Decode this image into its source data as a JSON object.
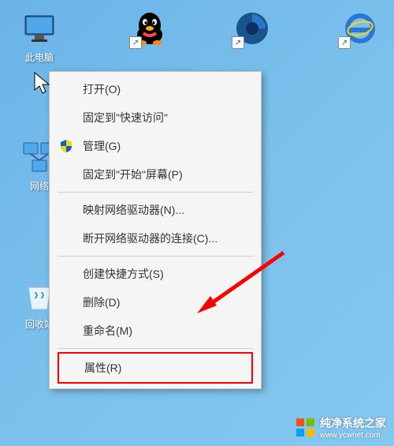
{
  "desktop": {
    "icons": {
      "computer": "此电脑",
      "qq": "",
      "360": "",
      "ie": "",
      "network": "网络",
      "recycle": "回收站"
    }
  },
  "context_menu": {
    "items": {
      "open": "打开(O)",
      "pin_quick": "固定到\"快速访问\"",
      "manage": "管理(G)",
      "pin_start": "固定到\"开始\"屏幕(P)",
      "map_drive": "映射网络驱动器(N)...",
      "disconnect": "断开网络驱动器的连接(C)...",
      "shortcut": "创建快捷方式(S)",
      "delete": "删除(D)",
      "rename": "重命名(M)",
      "properties": "属性(R)"
    }
  },
  "watermark": {
    "text": "纯净系统之家",
    "url": "www.ycwnet.com"
  }
}
